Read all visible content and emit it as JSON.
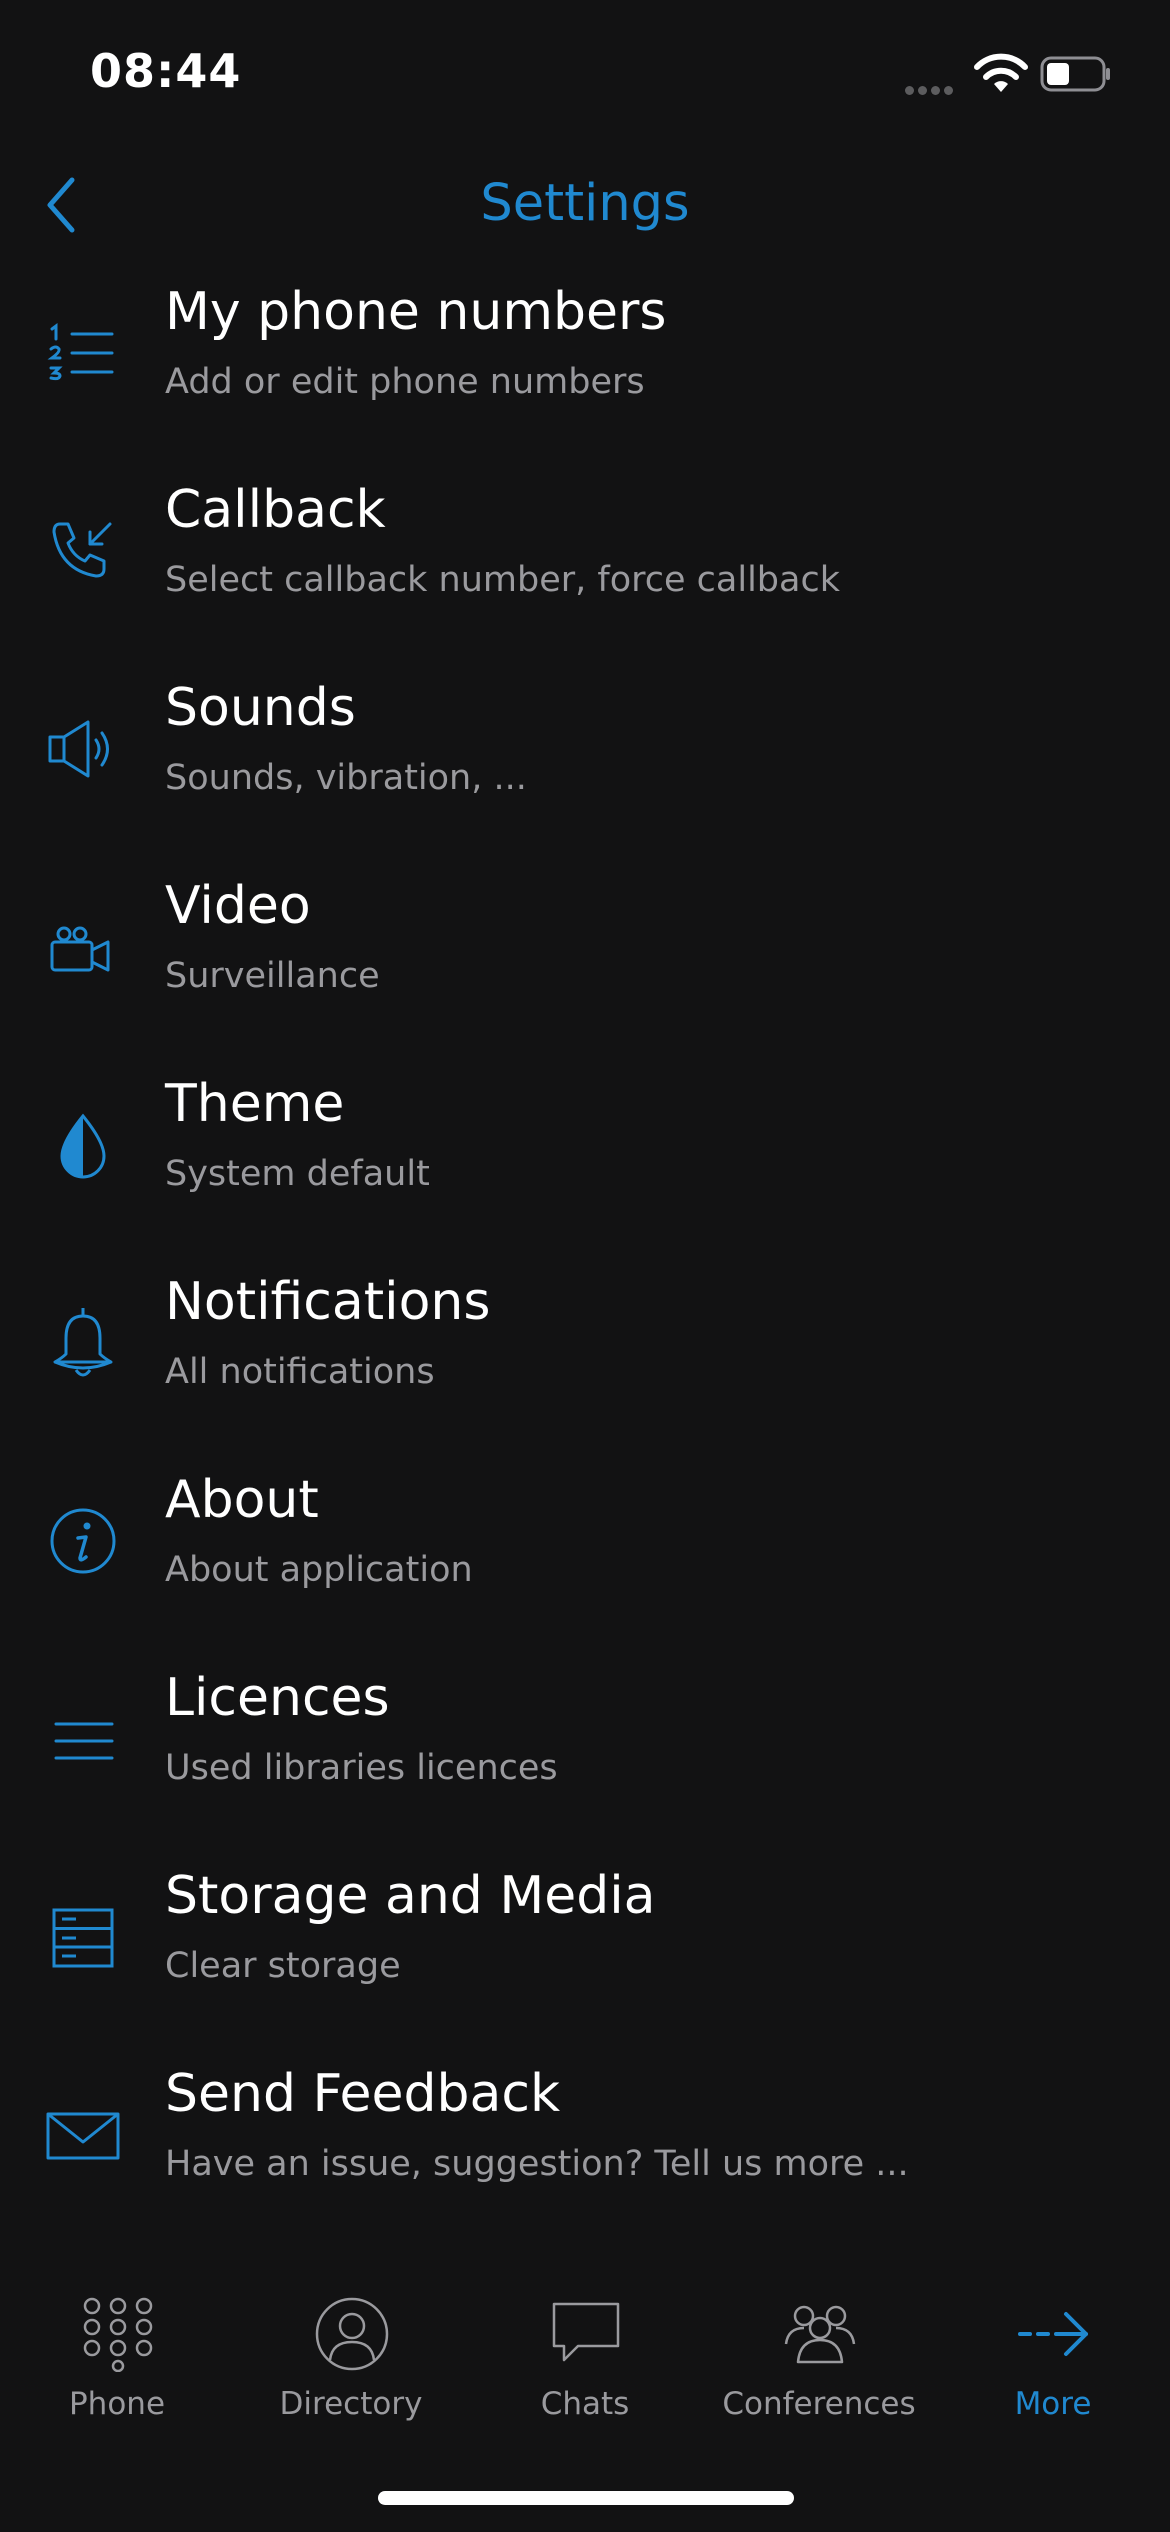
{
  "status": {
    "time": "08:44"
  },
  "nav": {
    "title": "Settings"
  },
  "items": [
    {
      "title": "My phone numbers",
      "subtitle": "Add or edit phone numbers",
      "icon": "numbered-list-icon"
    },
    {
      "title": "Callback",
      "subtitle": "Select callback number, force callback",
      "icon": "incoming-call-icon"
    },
    {
      "title": "Sounds",
      "subtitle": "Sounds, vibration, ...",
      "icon": "speaker-icon"
    },
    {
      "title": "Video",
      "subtitle": "Surveillance",
      "icon": "video-camera-icon"
    },
    {
      "title": "Theme",
      "subtitle": "System default",
      "icon": "drop-icon"
    },
    {
      "title": "Notifications",
      "subtitle": "All notifications",
      "icon": "bell-icon"
    },
    {
      "title": "About",
      "subtitle": "About application",
      "icon": "info-icon"
    },
    {
      "title": "Licences",
      "subtitle": "Used libraries licences",
      "icon": "lines-icon"
    },
    {
      "title": "Storage and Media",
      "subtitle": "Clear storage",
      "icon": "storage-icon"
    },
    {
      "title": "Send Feedback",
      "subtitle": "Have an issue, suggestion? Tell us more ...",
      "icon": "envelope-icon"
    }
  ],
  "tabs": [
    {
      "label": "Phone",
      "icon": "keypad-icon"
    },
    {
      "label": "Directory",
      "icon": "person-icon"
    },
    {
      "label": "Chats",
      "icon": "chat-bubble-icon"
    },
    {
      "label": "Conferences",
      "icon": "group-icon"
    },
    {
      "label": "More",
      "icon": "arrow-right-icon",
      "active": true
    }
  ],
  "colors": {
    "accent": "#2089d0",
    "background": "#121213",
    "subtitle": "#9a9a9e",
    "tab_inactive": "#9a9a9e"
  }
}
